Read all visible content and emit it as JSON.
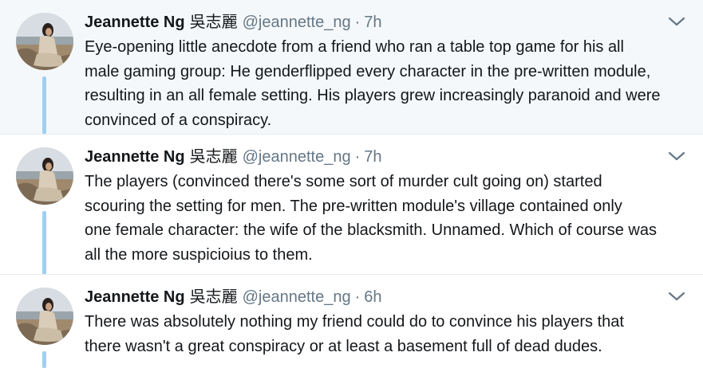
{
  "tweets": [
    {
      "author": {
        "name": "Jeannette Ng",
        "name_cjk": "吳志麗",
        "handle": "@jeannette_ng"
      },
      "separator": "·",
      "time": "7h",
      "lines": [
        "Eye-opening little anecdote from a friend who ran a table top game for his all",
        "male gaming group: He genderflipped every character in the pre-written module,",
        "resulting in an all female setting. His players grew increasingly paranoid and were",
        "convinced of a conspiracy."
      ],
      "menu_icon": "chevron-down-icon"
    },
    {
      "author": {
        "name": "Jeannette Ng",
        "name_cjk": "吳志麗",
        "handle": "@jeannette_ng"
      },
      "separator": "·",
      "time": "7h",
      "lines": [
        "The players (convinced there's some sort of murder cult going on) started",
        "scouring the setting for men. The pre-written module's village contained only",
        "one female character: the wife of the blacksmith. Unnamed. Which of course was",
        "all the more suspicioius to them."
      ],
      "menu_icon": "chevron-down-icon"
    },
    {
      "author": {
        "name": "Jeannette Ng",
        "name_cjk": "吳志麗",
        "handle": "@jeannette_ng"
      },
      "separator": "·",
      "time": "6h",
      "lines": [
        "There was absolutely nothing my friend could do to convince his players that",
        "there wasn't a great conspiracy or at least a basement full of dead dudes."
      ],
      "menu_icon": "chevron-down-icon"
    }
  ],
  "colors": {
    "highlight_background": "#f5f8fa",
    "thread_line": "#9fd0f2",
    "text_primary": "#14171a",
    "text_secondary": "#657786",
    "divider": "#e6ecf0"
  }
}
